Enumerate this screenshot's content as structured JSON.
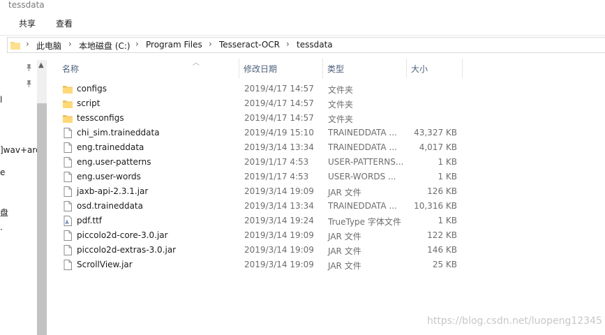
{
  "window": {
    "title": "tessdata"
  },
  "ribbon": {
    "tabs": [
      "共享",
      "查看"
    ]
  },
  "address": {
    "breadcrumbs": [
      "此电脑",
      "本地磁盘 (C:)",
      "Program Files",
      "Tesseract-OCR",
      "tessdata"
    ],
    "separator": "›"
  },
  "navpane": {
    "fragments": [
      "l",
      "]wav+arc",
      "e",
      "盘",
      "·"
    ]
  },
  "columns": {
    "name": "名称",
    "date": "修改日期",
    "type": "类型",
    "size": "大小"
  },
  "files": [
    {
      "name": "configs",
      "date": "2019/4/17 14:57",
      "type": "文件夹",
      "size": "",
      "icon": "folder-icon"
    },
    {
      "name": "script",
      "date": "2019/4/17 14:57",
      "type": "文件夹",
      "size": "",
      "icon": "folder-icon"
    },
    {
      "name": "tessconfigs",
      "date": "2019/4/17 14:57",
      "type": "文件夹",
      "size": "",
      "icon": "folder-icon"
    },
    {
      "name": "chi_sim.traineddata",
      "date": "2019/4/19 15:10",
      "type": "TRAINEDDATA ...",
      "size": "43,327 KB",
      "icon": "file-icon"
    },
    {
      "name": "eng.traineddata",
      "date": "2019/3/14 13:34",
      "type": "TRAINEDDATA ...",
      "size": "4,017 KB",
      "icon": "file-icon"
    },
    {
      "name": "eng.user-patterns",
      "date": "2019/1/17 4:53",
      "type": "USER-PATTERNS...",
      "size": "1 KB",
      "icon": "file-icon"
    },
    {
      "name": "eng.user-words",
      "date": "2019/1/17 4:53",
      "type": "USER-WORDS ...",
      "size": "1 KB",
      "icon": "file-icon"
    },
    {
      "name": "jaxb-api-2.3.1.jar",
      "date": "2019/3/14 19:09",
      "type": "JAR 文件",
      "size": "126 KB",
      "icon": "file-icon"
    },
    {
      "name": "osd.traineddata",
      "date": "2019/3/14 13:34",
      "type": "TRAINEDDATA ...",
      "size": "10,316 KB",
      "icon": "file-icon"
    },
    {
      "name": "pdf.ttf",
      "date": "2019/3/14 19:24",
      "type": "TrueType 字体文件",
      "size": "1 KB",
      "icon": "font-file-icon"
    },
    {
      "name": "piccolo2d-core-3.0.jar",
      "date": "2019/3/14 19:09",
      "type": "JAR 文件",
      "size": "122 KB",
      "icon": "file-icon"
    },
    {
      "name": "piccolo2d-extras-3.0.jar",
      "date": "2019/3/14 19:09",
      "type": "JAR 文件",
      "size": "146 KB",
      "icon": "file-icon"
    },
    {
      "name": "ScrollView.jar",
      "date": "2019/3/14 19:09",
      "type": "JAR 文件",
      "size": "25 KB",
      "icon": "file-icon"
    }
  ],
  "watermark": "https://blog.csdn.net/luopeng12345"
}
